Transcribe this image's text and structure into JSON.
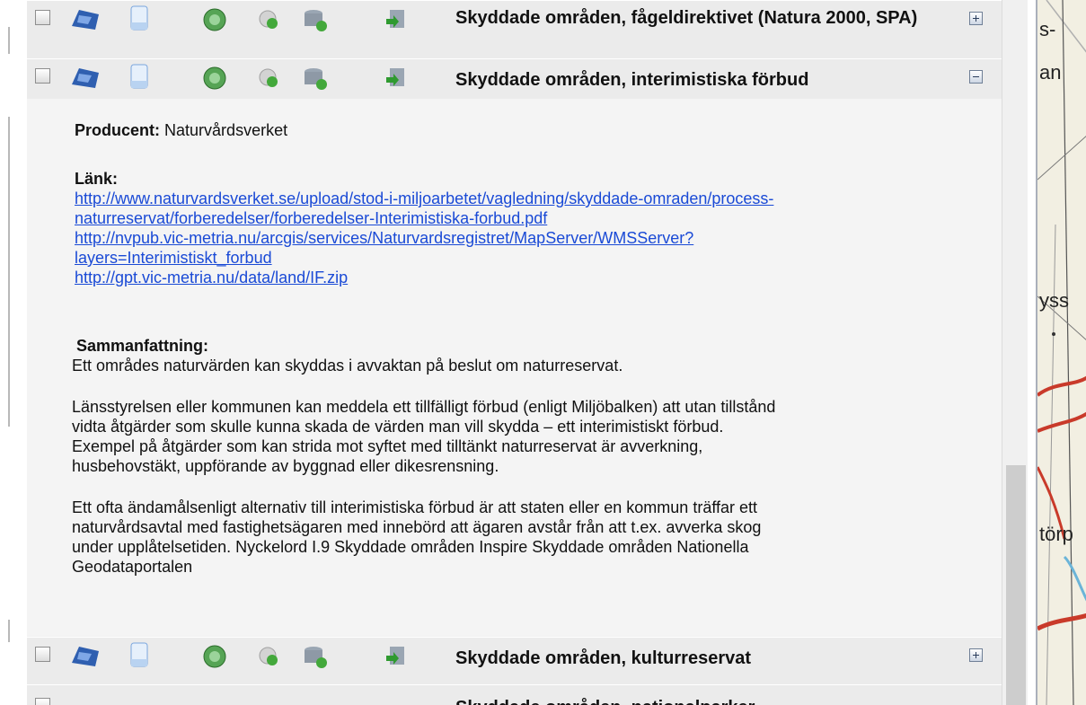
{
  "layers": [
    {
      "title": "Skyddade områden, fågeldirektivet (Natura 2000, SPA)",
      "checked": false,
      "expanded": false
    },
    {
      "title": "Skyddade områden, interimistiska förbud",
      "checked": false,
      "expanded": true
    },
    {
      "title": "Skyddade områden, kulturreservat",
      "checked": false,
      "expanded": false
    },
    {
      "title": "Skyddade områden, nationalparker",
      "checked": false,
      "expanded": false
    }
  ],
  "details": {
    "producer_label": "Producent:",
    "producer_value": "Naturvårdsverket",
    "link_label": "Länk:",
    "links": [
      "http://www.naturvardsverket.se/upload/stod-i-miljoarbetet/vagledning/skyddade-omraden/process-",
      "naturreservat/forberedelser/forberedelser-Interimistiska-forbud.pdf",
      "http://nvpub.vic-metria.nu/arcgis/services/Naturvardsregistret/MapServer/WMSServer?",
      "layers=Interimistiskt_forbud",
      "http://gpt.vic-metria.nu/data/land/IF.zip"
    ],
    "summary_label": "Sammanfattning:",
    "summary_lines": [
      "Ett områdes naturvärden kan skyddas i avvaktan på beslut om naturreservat.",
      "",
      "Länsstyrelsen eller kommunen kan meddela ett tillfälligt förbud (enligt Miljöbalken) att utan tillstånd",
      "vidta åtgärder som skulle kunna skada de värden man vill skydda – ett interimistiskt förbud.",
      "Exempel på åtgärder som kan strida mot syftet med tilltänkt naturreservat är avverkning,",
      "husbehovstäkt, uppförande av byggnad eller dikesrensning.",
      "",
      "Ett ofta ändamålsenligt alternativ till interimistiska förbud är att staten eller en kommun träffar ett",
      "naturvårdsavtal med fastighetsägaren med innebörd att ägaren avstår från att t.ex. avverka skog",
      "under upplåtelsetiden. Nyckelord I.9 Skyddade områden Inspire Skyddade områden Nationella",
      "Geodataportalen"
    ]
  },
  "map_labels": [
    "s-",
    "an",
    "yss",
    "törp"
  ],
  "colors": {
    "link": "#1a4ad6",
    "panel": "#ebebeb",
    "map": "#f2efe2"
  }
}
